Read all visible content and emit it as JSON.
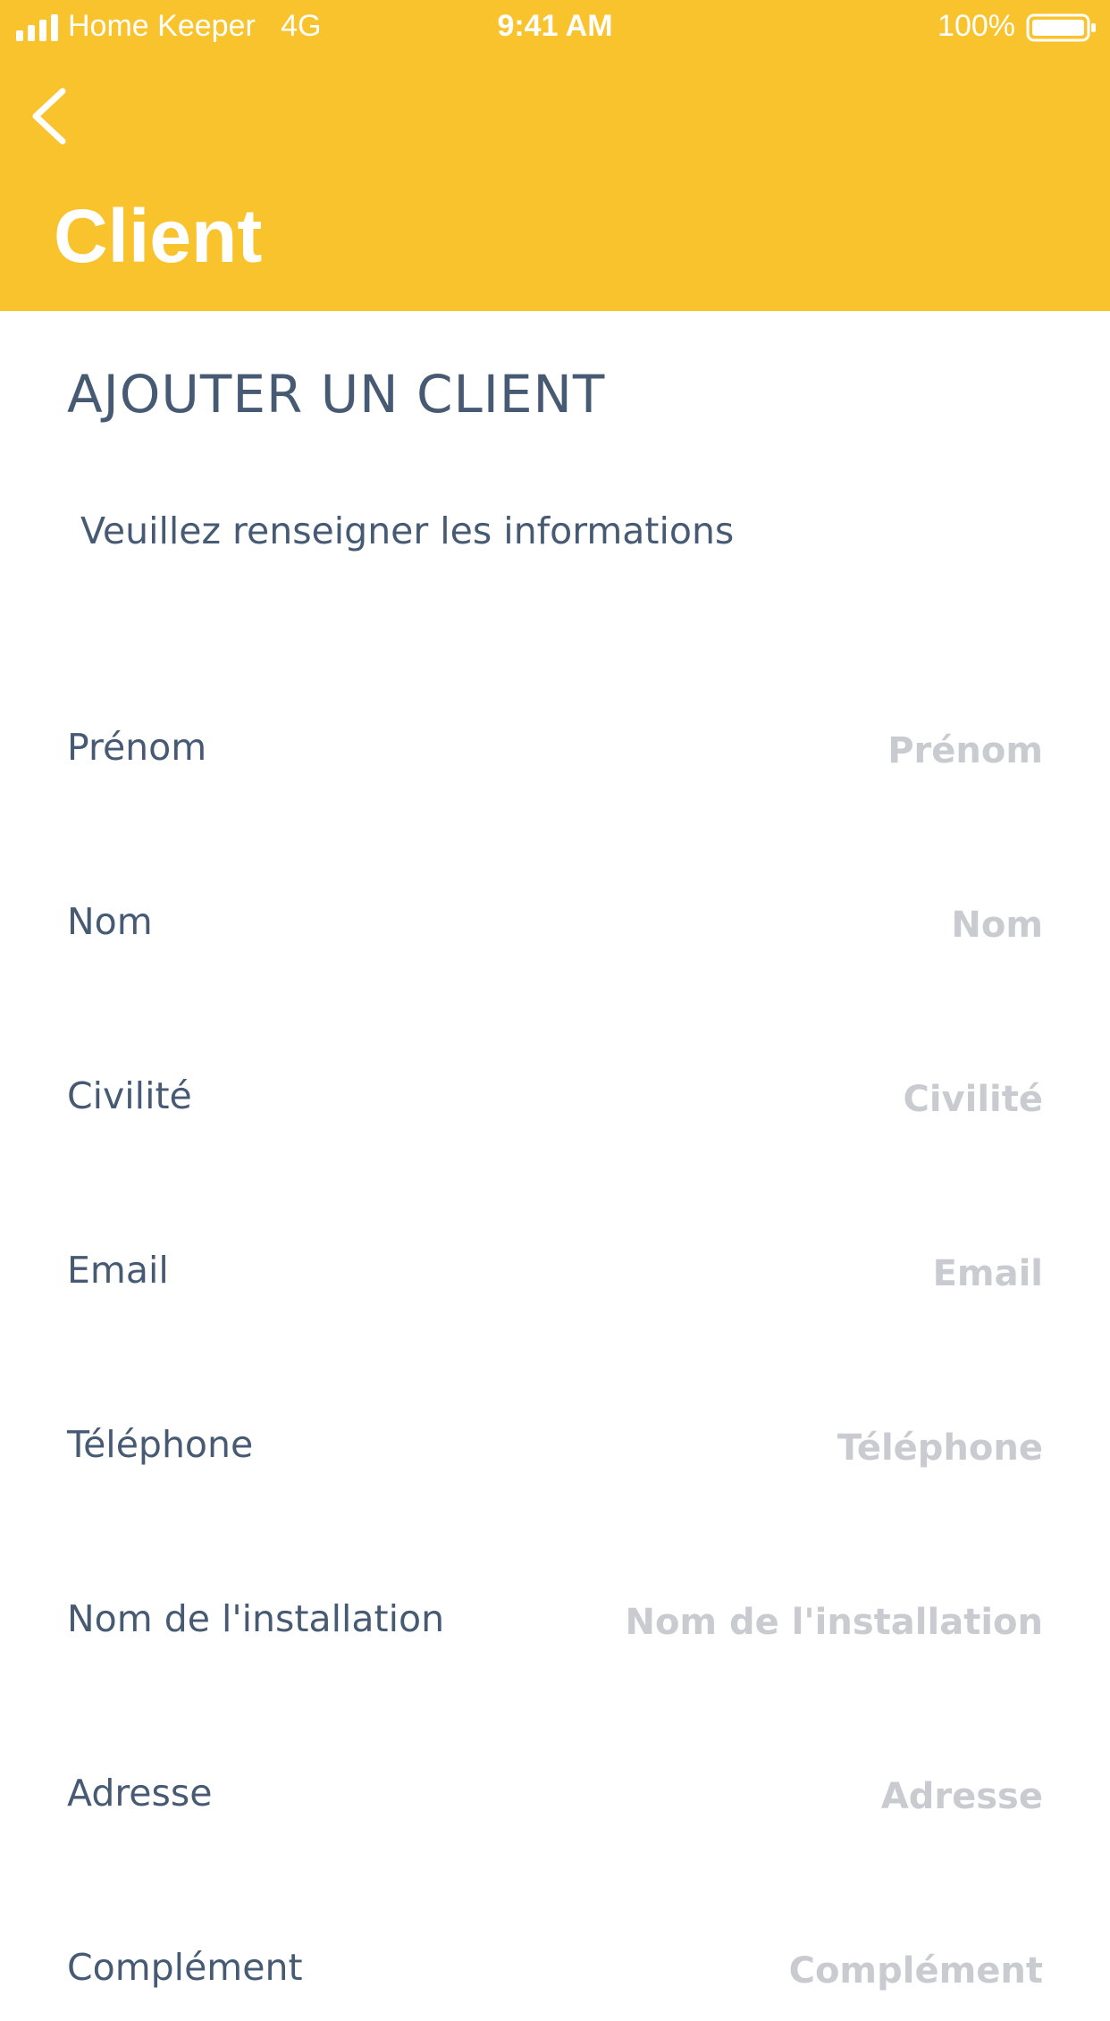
{
  "status_bar": {
    "carrier": "Home Keeper",
    "network": "4G",
    "time": "9:41 AM",
    "battery": "100%"
  },
  "header": {
    "title": "Client",
    "back_icon": "chevron-left-icon",
    "background_color": "#F9C32D"
  },
  "form": {
    "heading": "AJOUTER UN CLIENT",
    "subtitle": "Veuillez renseigner les informations",
    "fields": [
      {
        "label": "Prénom",
        "placeholder": "Prénom",
        "value": ""
      },
      {
        "label": "Nom",
        "placeholder": "Nom",
        "value": ""
      },
      {
        "label": "Civilité",
        "placeholder": "Civilité",
        "value": ""
      },
      {
        "label": "Email",
        "placeholder": "Email",
        "value": ""
      },
      {
        "label": "Téléphone",
        "placeholder": "Téléphone",
        "value": ""
      },
      {
        "label": "Nom de l'installation",
        "placeholder": "Nom de l'installation",
        "value": ""
      },
      {
        "label": "Adresse",
        "placeholder": "Adresse",
        "value": ""
      },
      {
        "label": "Complément",
        "placeholder": "Complément",
        "value": ""
      }
    ]
  },
  "colors": {
    "accent": "#F9C32D",
    "text": "#475A74",
    "placeholder": "#C9CBD1"
  }
}
